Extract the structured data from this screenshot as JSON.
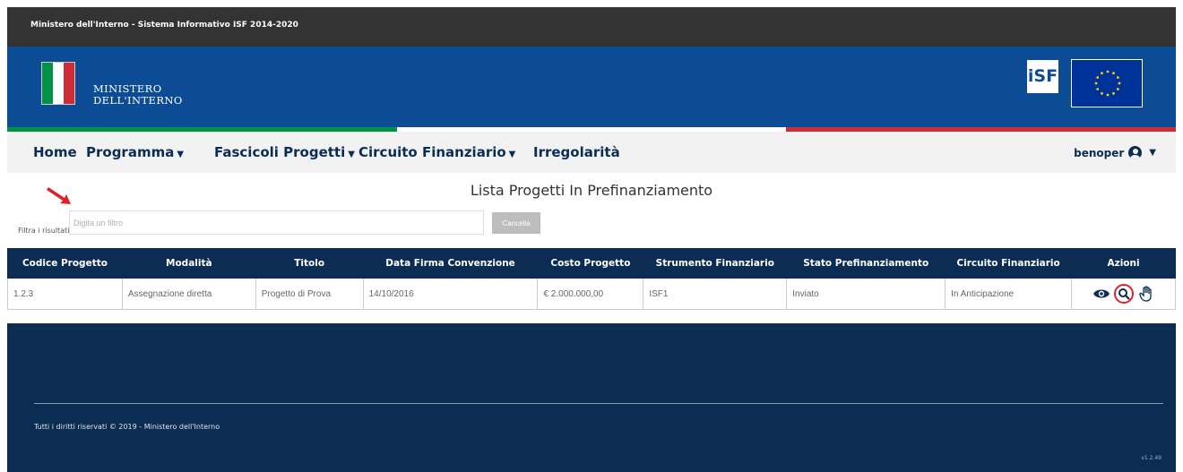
{
  "topbar": {
    "title": "Ministero dell'Interno - Sistema Informativo ISF 2014-2020"
  },
  "header": {
    "brand_line1": "MINISTERO",
    "brand_line2": "DELL'INTERNO",
    "isf_logo": "iSF",
    "eu_logo_icon": "eu-flag-icon",
    "italy_colors": [
      "#009246",
      "#ffffff",
      "#ce2b37"
    ]
  },
  "nav": {
    "items": [
      {
        "label": "Home",
        "dropdown": false
      },
      {
        "label": "Programma",
        "dropdown": true
      },
      {
        "label": "Fascicoli Progetti",
        "dropdown": true
      },
      {
        "label": "Circuito Finanziario",
        "dropdown": true
      },
      {
        "label": "Irregolarità",
        "dropdown": false
      }
    ],
    "user": "benoper",
    "user_icon": "user-circle-icon"
  },
  "page": {
    "title": "Lista Progetti In Prefinanziamento",
    "filter_label": "Filtra i risultati:",
    "filter_placeholder": "Digita un filtro",
    "cancel_label": "Cancella"
  },
  "table": {
    "headers": [
      "Codice Progetto",
      "Modalità",
      "Titolo",
      "Data Firma Convenzione",
      "Costo Progetto",
      "Strumento Finanziario",
      "Stato Prefinanziamento",
      "Circuito Finanziario",
      "Azioni"
    ],
    "rows": [
      [
        "1.2.3",
        "Assegnazione diretta",
        "Progetto di Prova",
        "14/10/2016",
        "€ 2.000.000,00",
        "ISF1",
        "Inviato",
        "In Anticipazione"
      ]
    ],
    "action_icons": [
      "eye-icon",
      "magnifier-icon",
      "hand-icon"
    ]
  },
  "footer": {
    "copyright": "Tutti i diritti riservati © 2019 - Ministero dell'Interno",
    "version": "v1.2.49"
  },
  "colors": {
    "header_blue": "#0b4c94",
    "navy": "#0b2d54",
    "topbar": "#333333",
    "highlight": "#e0202a"
  }
}
